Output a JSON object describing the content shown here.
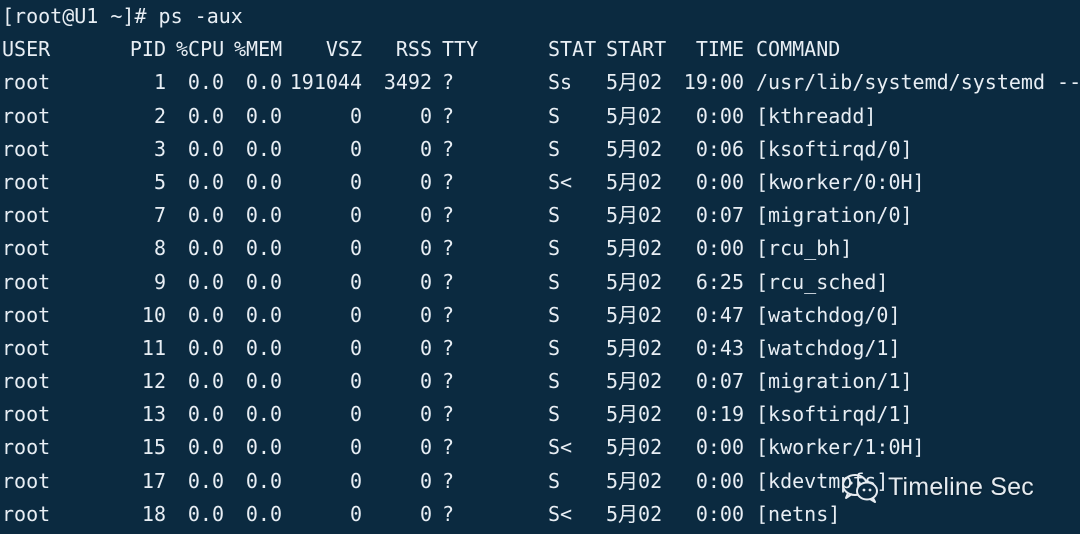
{
  "terminal": {
    "prompt": "[root@U1 ~]# ps -aux",
    "colors": {
      "background": "#0b2a40",
      "text": "#e8eef4"
    },
    "headers": {
      "user": "USER",
      "pid": "PID",
      "cpu": "%CPU",
      "mem": "%MEM",
      "vsz": "VSZ",
      "rss": "RSS",
      "tty": "TTY",
      "stat": "STAT",
      "start": "START",
      "time": "TIME",
      "command": "COMMAND"
    },
    "rows": [
      {
        "user": "root",
        "pid": "1",
        "cpu": "0.0",
        "mem": "0.0",
        "vsz": "191044",
        "rss": "3492",
        "tty": "?",
        "stat": "Ss",
        "start": "5月02",
        "time": "19:00",
        "command": "/usr/lib/systemd/systemd --s"
      },
      {
        "user": "root",
        "pid": "2",
        "cpu": "0.0",
        "mem": "0.0",
        "vsz": "0",
        "rss": "0",
        "tty": "?",
        "stat": "S",
        "start": "5月02",
        "time": "0:00",
        "command": "[kthreadd]"
      },
      {
        "user": "root",
        "pid": "3",
        "cpu": "0.0",
        "mem": "0.0",
        "vsz": "0",
        "rss": "0",
        "tty": "?",
        "stat": "S",
        "start": "5月02",
        "time": "0:06",
        "command": "[ksoftirqd/0]"
      },
      {
        "user": "root",
        "pid": "5",
        "cpu": "0.0",
        "mem": "0.0",
        "vsz": "0",
        "rss": "0",
        "tty": "?",
        "stat": "S<",
        "start": "5月02",
        "time": "0:00",
        "command": "[kworker/0:0H]"
      },
      {
        "user": "root",
        "pid": "7",
        "cpu": "0.0",
        "mem": "0.0",
        "vsz": "0",
        "rss": "0",
        "tty": "?",
        "stat": "S",
        "start": "5月02",
        "time": "0:07",
        "command": "[migration/0]"
      },
      {
        "user": "root",
        "pid": "8",
        "cpu": "0.0",
        "mem": "0.0",
        "vsz": "0",
        "rss": "0",
        "tty": "?",
        "stat": "S",
        "start": "5月02",
        "time": "0:00",
        "command": "[rcu_bh]"
      },
      {
        "user": "root",
        "pid": "9",
        "cpu": "0.0",
        "mem": "0.0",
        "vsz": "0",
        "rss": "0",
        "tty": "?",
        "stat": "S",
        "start": "5月02",
        "time": "6:25",
        "command": "[rcu_sched]"
      },
      {
        "user": "root",
        "pid": "10",
        "cpu": "0.0",
        "mem": "0.0",
        "vsz": "0",
        "rss": "0",
        "tty": "?",
        "stat": "S",
        "start": "5月02",
        "time": "0:47",
        "command": "[watchdog/0]"
      },
      {
        "user": "root",
        "pid": "11",
        "cpu": "0.0",
        "mem": "0.0",
        "vsz": "0",
        "rss": "0",
        "tty": "?",
        "stat": "S",
        "start": "5月02",
        "time": "0:43",
        "command": "[watchdog/1]"
      },
      {
        "user": "root",
        "pid": "12",
        "cpu": "0.0",
        "mem": "0.0",
        "vsz": "0",
        "rss": "0",
        "tty": "?",
        "stat": "S",
        "start": "5月02",
        "time": "0:07",
        "command": "[migration/1]"
      },
      {
        "user": "root",
        "pid": "13",
        "cpu": "0.0",
        "mem": "0.0",
        "vsz": "0",
        "rss": "0",
        "tty": "?",
        "stat": "S",
        "start": "5月02",
        "time": "0:19",
        "command": "[ksoftirqd/1]"
      },
      {
        "user": "root",
        "pid": "15",
        "cpu": "0.0",
        "mem": "0.0",
        "vsz": "0",
        "rss": "0",
        "tty": "?",
        "stat": "S<",
        "start": "5月02",
        "time": "0:00",
        "command": "[kworker/1:0H]"
      },
      {
        "user": "root",
        "pid": "17",
        "cpu": "0.0",
        "mem": "0.0",
        "vsz": "0",
        "rss": "0",
        "tty": "?",
        "stat": "S",
        "start": "5月02",
        "time": "0:00",
        "command": "[kdevtmpfs]"
      },
      {
        "user": "root",
        "pid": "18",
        "cpu": "0.0",
        "mem": "0.0",
        "vsz": "0",
        "rss": "0",
        "tty": "?",
        "stat": "S<",
        "start": "5月02",
        "time": "0:00",
        "command": "[netns]"
      }
    ]
  },
  "watermark": {
    "text": "Timeline Sec",
    "icon": "wechat-icon"
  }
}
